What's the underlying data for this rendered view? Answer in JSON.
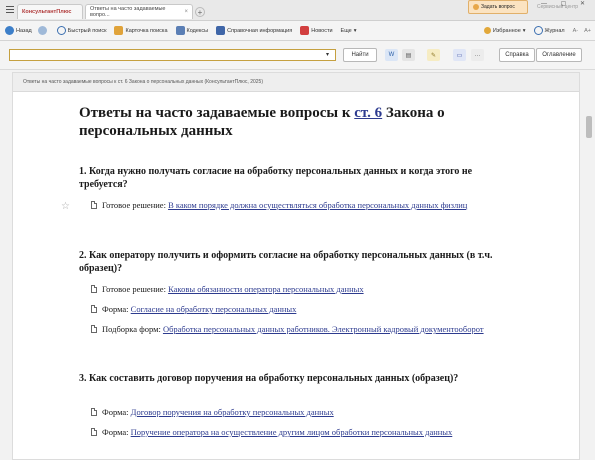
{
  "tabs": {
    "logo": "КонсультантПлюс",
    "active": "Ответы на часто задаваемые вопро..."
  },
  "top_right": {
    "ask": "Задать вопрос",
    "service": "Сервисный центр",
    "win": "— ▢ ✕"
  },
  "toolbar": {
    "back": "Назад",
    "quick": "Быстрый поиск",
    "card": "Карточка поиска",
    "codex": "Кодексы",
    "ref": "Справочная информация",
    "news": "Новости",
    "more": "Еще",
    "fav": "Избранное",
    "journal": "Журнал"
  },
  "search": {
    "value": "",
    "find_label": "Найти",
    "help_label": "Справка",
    "toc_label": "Оглавление"
  },
  "document": {
    "tab_title": "Ответы на часто задаваемые вопросы к ст. 6 Закона о персональных данных (КонсультантПлюс, 2025)",
    "title_pre": "Ответы на часто задаваемые вопросы к ",
    "title_link": "ст. 6",
    "title_post": " Закона о персональных данных",
    "sections": [
      {
        "q": "1. Когда нужно получать согласие на обработку персональных данных и когда этого не требуется?",
        "items": [
          {
            "prefix": "Готовое решение: ",
            "link": "В каком порядке должна осуществляться обработка персональных данных физлиц"
          }
        ]
      },
      {
        "q": "2. Как оператору получить и оформить согласие на обработку персональных данных (в т.ч. образец)?",
        "items": [
          {
            "prefix": "Готовое решение: ",
            "link": "Каковы обязанности оператора персональных данных"
          },
          {
            "prefix": "Форма: ",
            "link": "Согласие на обработку персональных данных"
          },
          {
            "prefix": "Подборка форм: ",
            "link": "Обработка персональных данных работников. Электронный кадровый документооборот"
          }
        ]
      },
      {
        "q": "3. Как составить договор поручения на обработку персональных данных (образец)?",
        "items": [
          {
            "prefix": "Форма: ",
            "link": "Договор поручения на обработку персональных данных"
          },
          {
            "prefix": "Форма: ",
            "link": "Поручение оператора на осуществление другим лицом обработки персональных данных"
          }
        ]
      }
    ]
  },
  "colors": {
    "link": "#2d3b8f",
    "accent": "#c5a040"
  }
}
